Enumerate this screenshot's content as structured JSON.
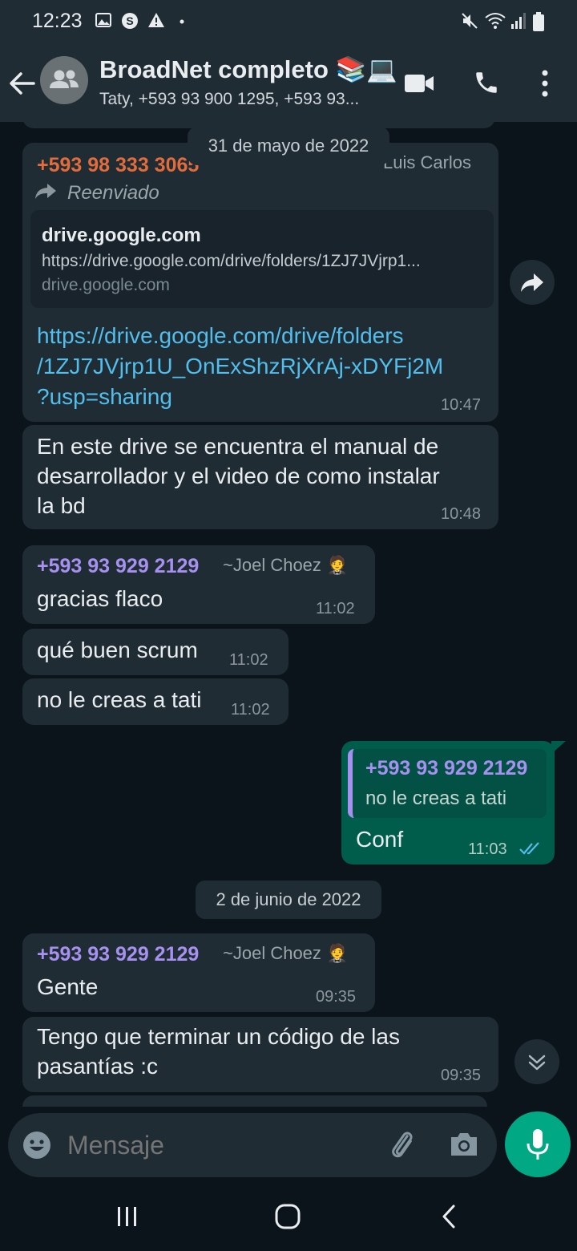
{
  "status_bar": {
    "time": "12:23"
  },
  "header": {
    "title": "BroadNet completo 📚💻",
    "subtitle": "Taty, +593 93 900 1295, +593 93..."
  },
  "dates": [
    "31 de mayo de 2022",
    "2 de junio de 2022"
  ],
  "messages": [
    {
      "sender": "+593 98 333 3065",
      "pushname": "Luis Carlos",
      "forwarded": "Reenviado",
      "preview": {
        "title": "drive.google.com",
        "description": "https://drive.google.com/drive/folders/1ZJ7JVjrp1...",
        "domain": "drive.google.com"
      },
      "link_lines": [
        "https://drive.google.com/drive/folders",
        "/1ZJ7JVjrp1U_OnExShzRjXrAj-xDYFj2M",
        "?usp=sharing"
      ],
      "time": "10:47"
    },
    {
      "lines": [
        "En este drive se encuentra el manual de",
        "desarrollador y el video de como instalar",
        "la bd"
      ],
      "time": "10:48"
    },
    {
      "sender": "+593 93 929 2129",
      "pushname": "~Joel Choez 🤵",
      "text": "gracias flaco",
      "time": "11:02"
    },
    {
      "text": "qué buen scrum",
      "time": "11:02"
    },
    {
      "text": "no le creas a tati",
      "time": "11:02"
    },
    {
      "quoted_sender": "+593 93 929 2129",
      "quoted_text": "no le creas a tati",
      "text": "Conf",
      "time": "11:03"
    },
    {
      "sender": "+593 93 929 2129",
      "pushname": "~Joel Choez 🤵",
      "text": "Gente",
      "time": "09:35"
    },
    {
      "lines": [
        "Tengo que terminar un código de las",
        "pasantías :c"
      ],
      "time": "09:35"
    }
  ],
  "input": {
    "placeholder": "Mensaje"
  },
  "colors": {
    "sender_luis": "#e26c3b",
    "sender_joel": "#a791f0",
    "link": "#53bdeb",
    "accent": "#00a884",
    "read_ticks": "#53bdeb"
  },
  "icons": [
    "back-arrow-icon",
    "group-avatar-icon",
    "video-call-icon",
    "phone-icon",
    "more-options-icon",
    "forward-icon",
    "scroll-down-icon",
    "emoji-icon",
    "attach-icon",
    "camera-icon",
    "mic-icon",
    "read-receipt-icon"
  ]
}
